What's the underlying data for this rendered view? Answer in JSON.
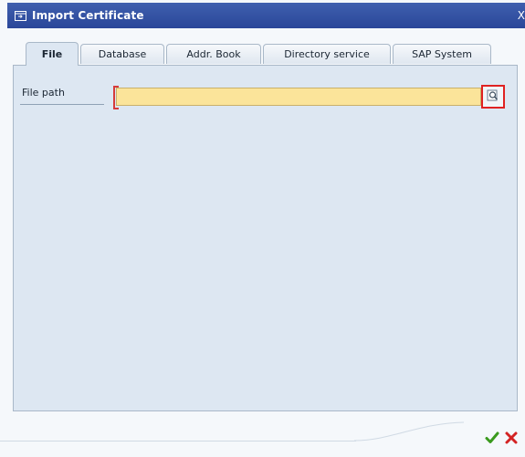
{
  "window": {
    "title": "Import Certificate",
    "close_glyph": "X"
  },
  "tabs": [
    {
      "label": "File",
      "active": true
    },
    {
      "label": "Database",
      "active": false
    },
    {
      "label": "Addr. Book",
      "active": false
    },
    {
      "label": "Directory service",
      "active": false
    },
    {
      "label": "SAP System",
      "active": false
    }
  ],
  "form": {
    "file_path_label": "File path",
    "file_path_value": "",
    "value_help_icon": "search-icon"
  },
  "footer": {
    "ok_icon": "checkmark-icon",
    "cancel_icon": "cancel-icon"
  },
  "colors": {
    "titlebar": "#2a4799",
    "panel": "#dde7f2",
    "input_required": "#fbe49a",
    "highlight": "#e02222",
    "ok": "#3a9a1e",
    "cancel": "#d32323"
  }
}
